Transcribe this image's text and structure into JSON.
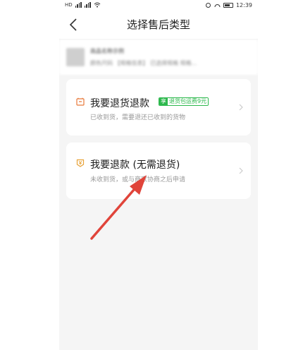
{
  "statusbar": {
    "left_text": "HD",
    "time": "12:39"
  },
  "navbar": {
    "title": "选择售后类型"
  },
  "product": {
    "name": "商品名称示例",
    "spec": "颜色尺码  【规格信息】  已选择规格  规格..."
  },
  "options": [
    {
      "title": "我要退货退款",
      "badge_tag": "享",
      "badge_text": "退货包运费9元",
      "subtitle": "已收到货，需要退还已收到的货物",
      "accent": "#e8793a"
    },
    {
      "title": "我要退款 (无需退货)",
      "subtitle": "未收到货，或与商家协商之后申请",
      "accent": "#e8a33a"
    }
  ],
  "colors": {
    "arrow": "#e0443a",
    "badge": "#2db84d"
  }
}
